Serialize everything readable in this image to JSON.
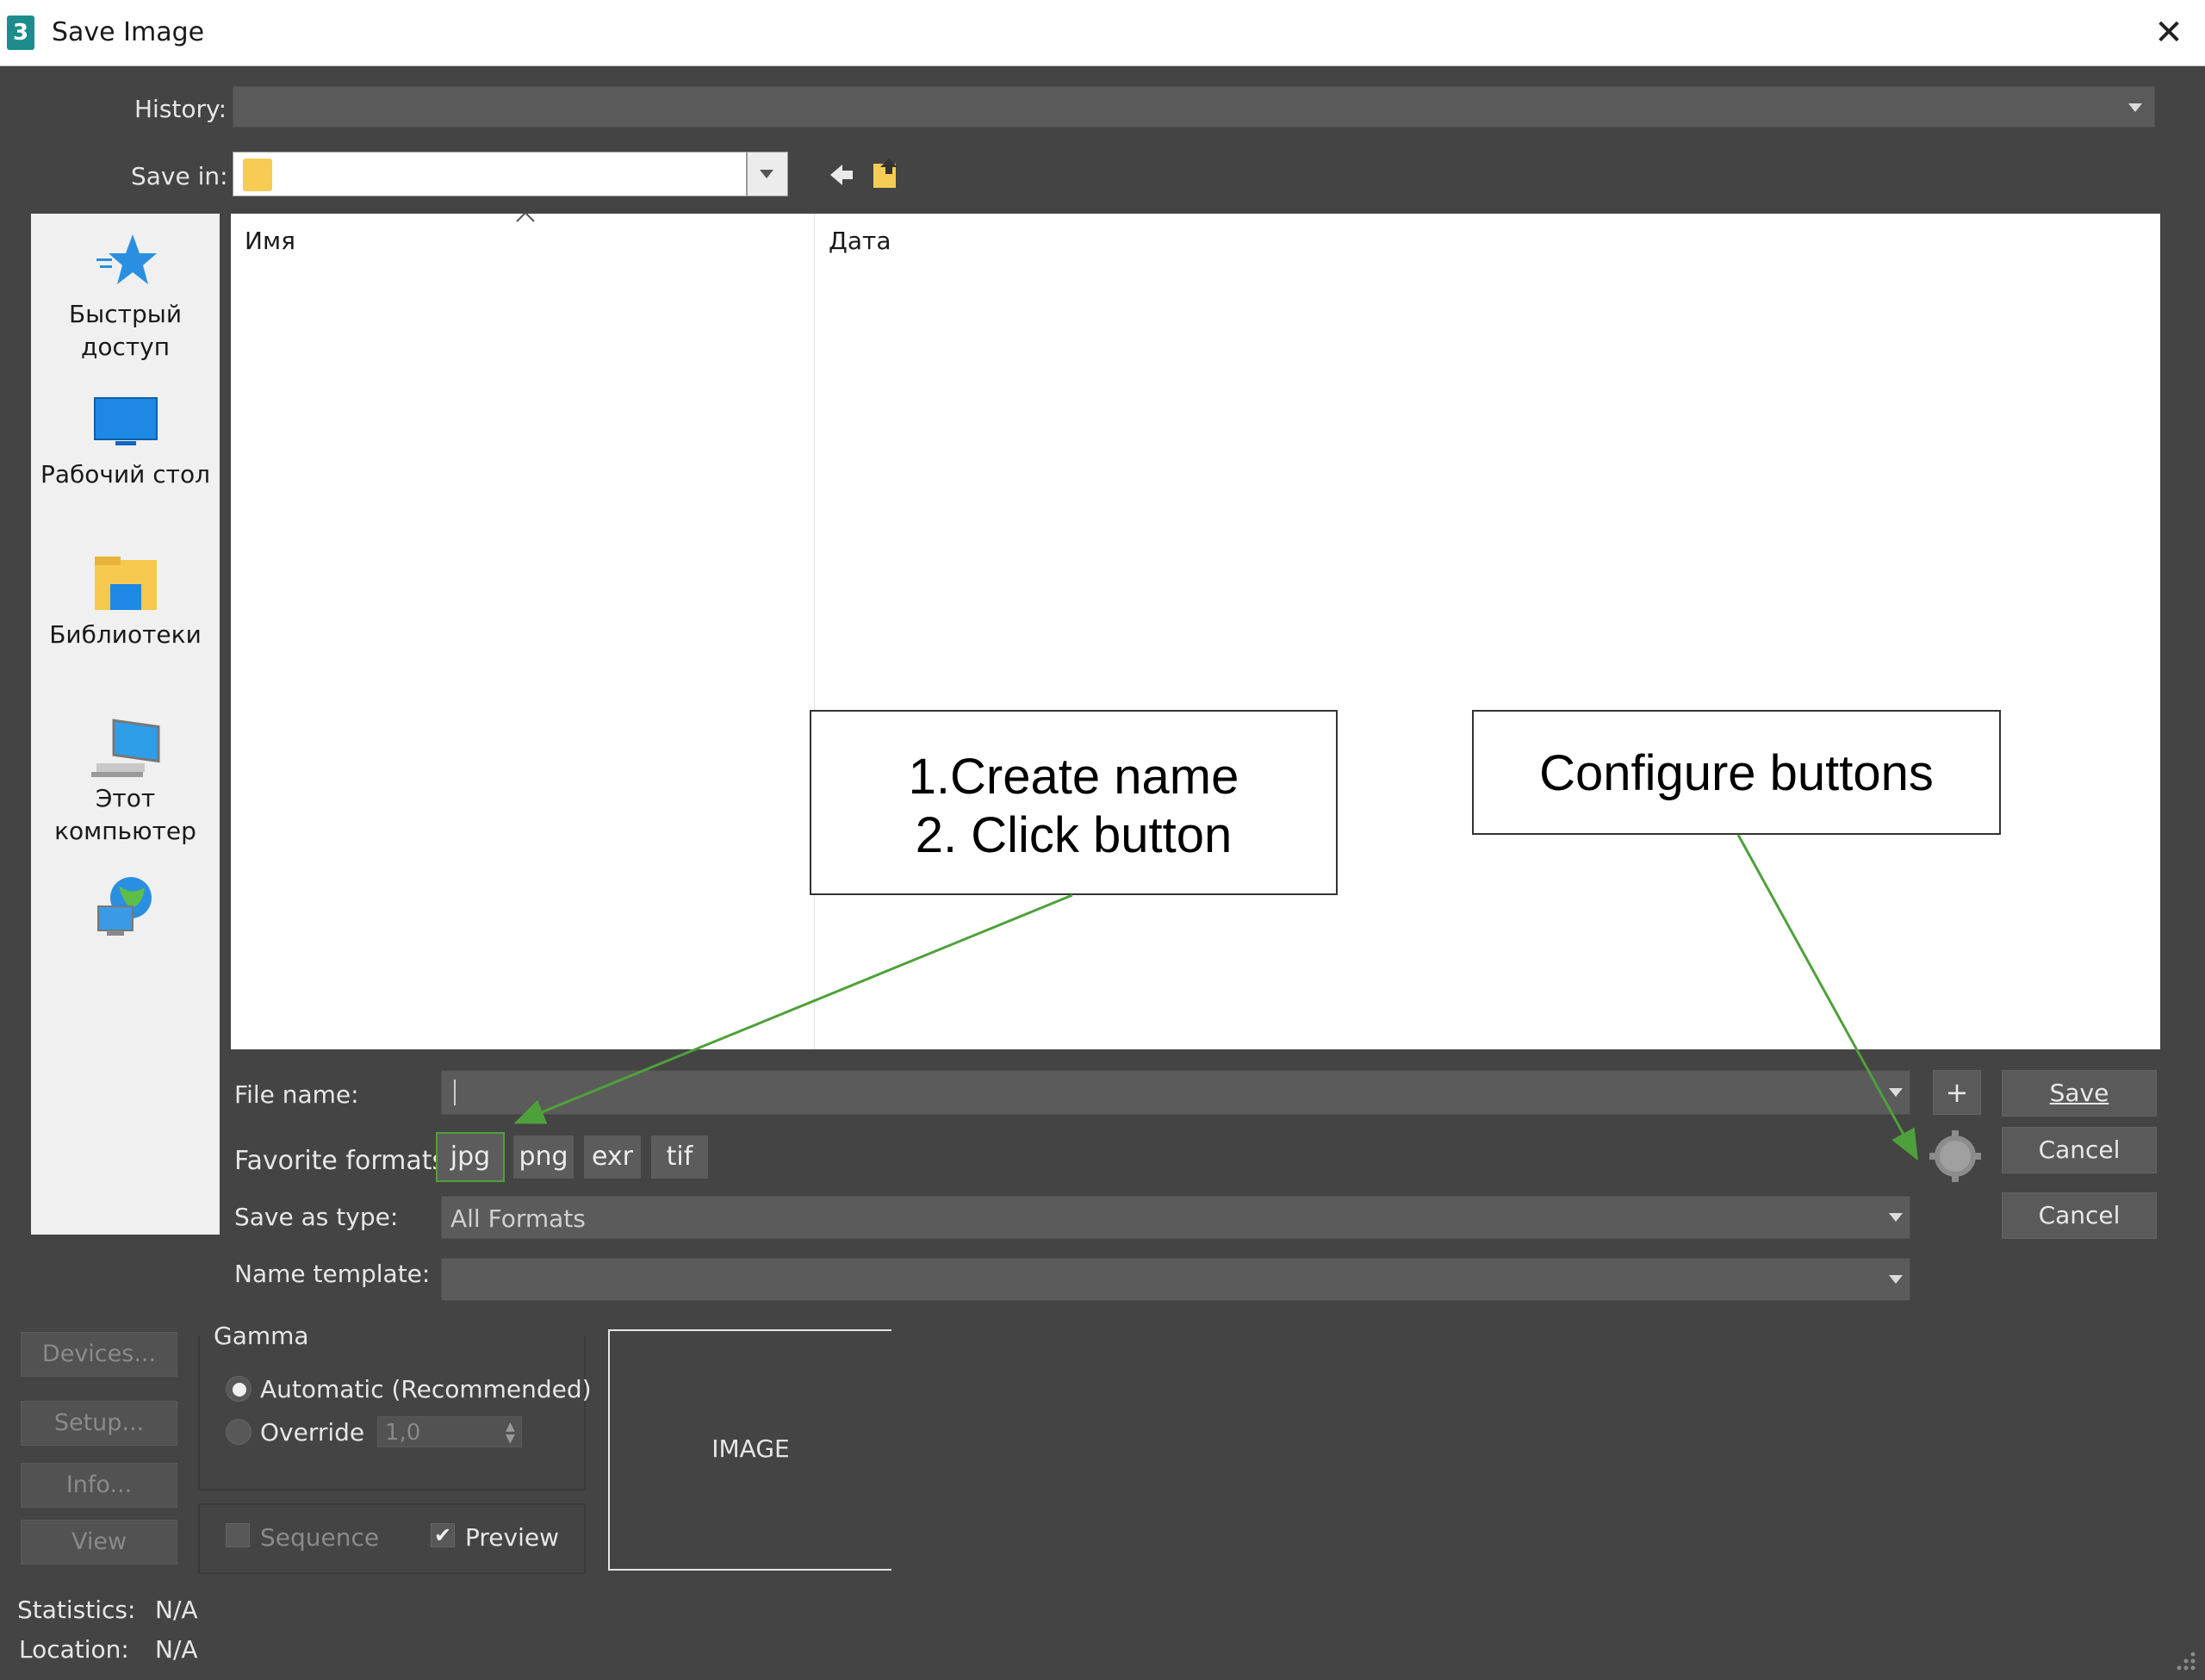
{
  "window": {
    "title": "Save Image",
    "app_icon": "3",
    "close_glyph": "✕"
  },
  "history": {
    "label": "History:",
    "value": ""
  },
  "save_in": {
    "label": "Save in:",
    "value": ""
  },
  "places": [
    {
      "label_line1": "Быстрый",
      "label_line2": "доступ",
      "icon": "star-icon"
    },
    {
      "label_line1": "Рабочий стол",
      "label_line2": "",
      "icon": "desktop-icon"
    },
    {
      "label_line1": "Библиотеки",
      "label_line2": "",
      "icon": "library-icon"
    },
    {
      "label_line1": "Этот",
      "label_line2": "компьютер",
      "icon": "computer-icon"
    },
    {
      "label_line1": "",
      "label_line2": "",
      "icon": "network-icon"
    }
  ],
  "file_list": {
    "columns": [
      "Имя",
      "Дата"
    ],
    "rows": []
  },
  "file_name": {
    "label": "File name:",
    "value": ""
  },
  "favorite_formats": {
    "label": "Favorite formats",
    "items": [
      "jpg",
      "png",
      "exr",
      "tif"
    ]
  },
  "save_as_type": {
    "label": "Save as type:",
    "value": "All Formats"
  },
  "name_template": {
    "label": "Name template:",
    "value": ""
  },
  "buttons": {
    "plus": "+",
    "save": "Save",
    "cancel1": "Cancel",
    "cancel2": "Cancel"
  },
  "side_buttons": {
    "devices": "Devices...",
    "setup": "Setup...",
    "info": "Info...",
    "view": "View"
  },
  "gamma": {
    "title": "Gamma",
    "automatic": "Automatic (Recommended)",
    "override": "Override",
    "override_value": "1,0"
  },
  "options": {
    "sequence": "Sequence",
    "preview": "Preview"
  },
  "preview": {
    "label": "IMAGE"
  },
  "stats": {
    "statistics_label": "Statistics:",
    "statistics_value": "N/A",
    "location_label": "Location:",
    "location_value": "N/A"
  },
  "callouts": {
    "left_line1": "1.Create name",
    "left_line2": "2. Click button",
    "right": "Configure buttons"
  },
  "colors": {
    "dialog_bg": "#444444",
    "arrow": "#4ea13a",
    "places_bg": "#f0f0f0"
  }
}
